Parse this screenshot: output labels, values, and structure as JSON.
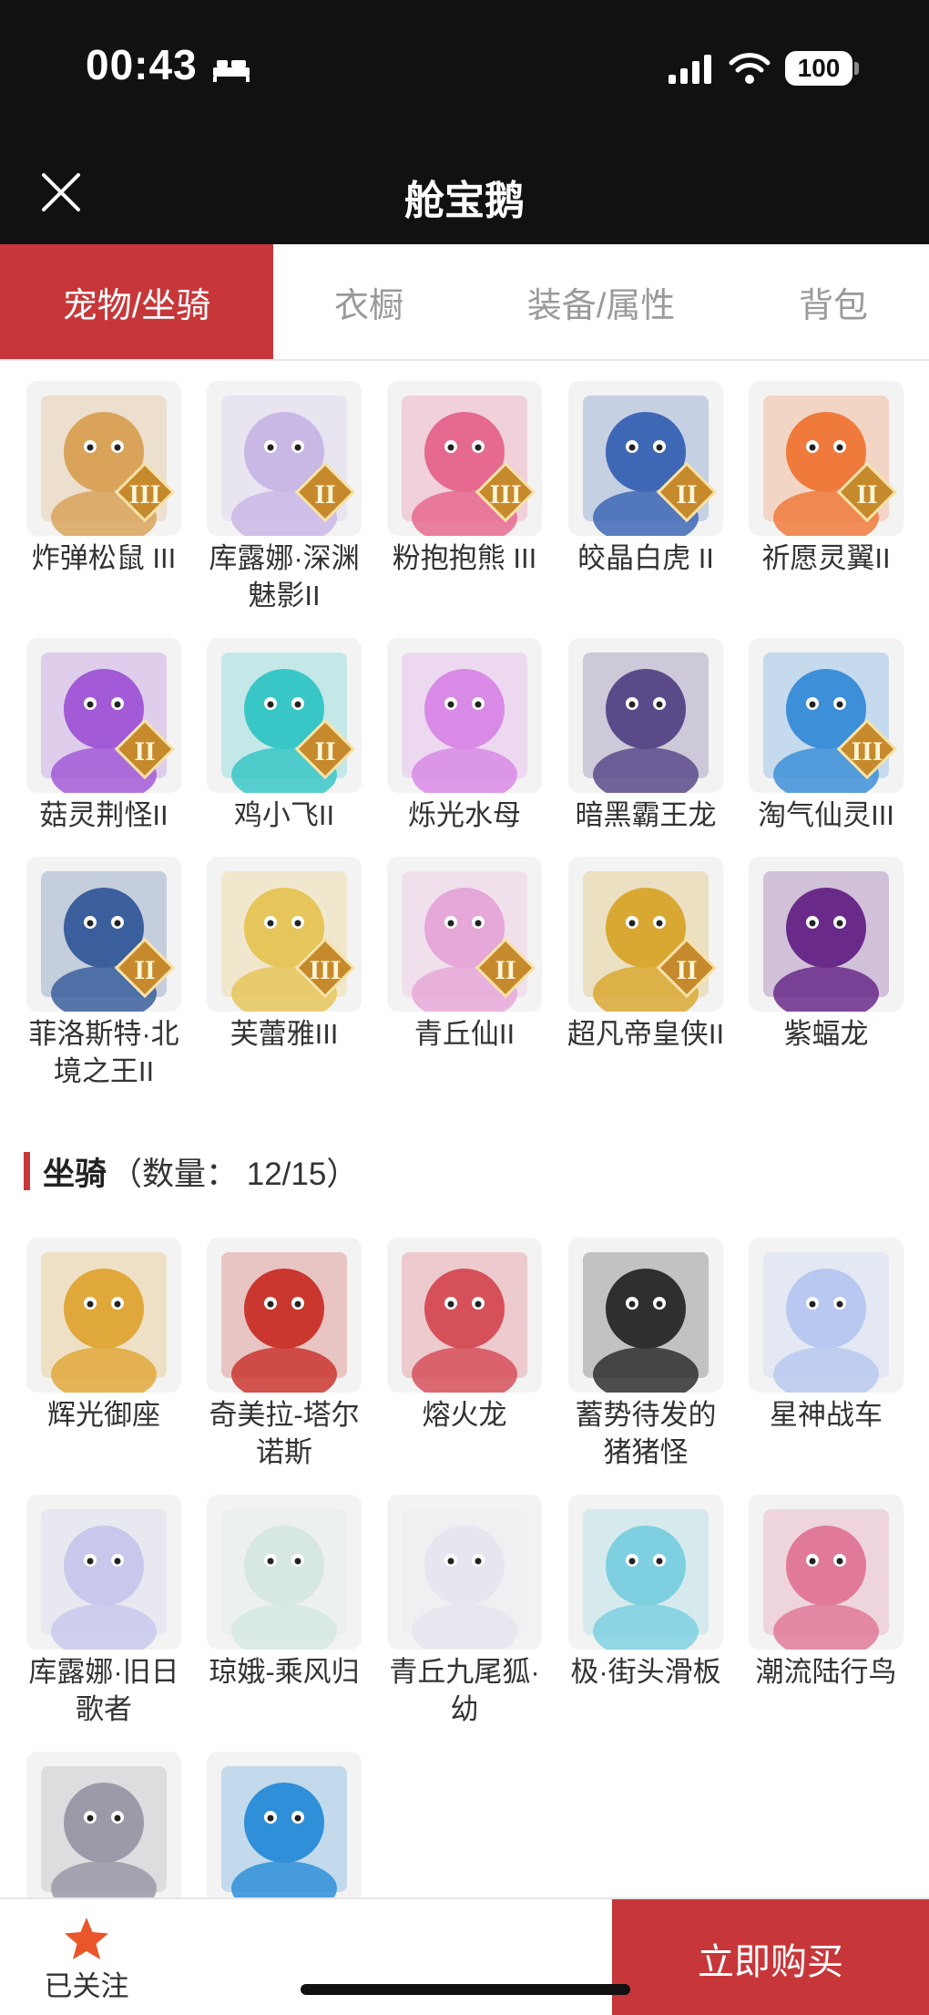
{
  "status_bar": {
    "time": "00:43",
    "battery": "100"
  },
  "app": {
    "title": "舱宝鹅"
  },
  "tabs": [
    {
      "label": "宠物/坐骑",
      "active": true
    },
    {
      "label": "衣橱",
      "active": false
    },
    {
      "label": "装备/属性",
      "active": false
    },
    {
      "label": "背包",
      "active": false
    }
  ],
  "pets": [
    {
      "name": "炸弹松鼠 III",
      "tier": "III",
      "color": "#d9a35a"
    },
    {
      "name": "库露娜·深渊魅影II",
      "tier": "II",
      "color": "#c9b7e6"
    },
    {
      "name": "粉抱抱熊 III",
      "tier": "III",
      "color": "#e66a8f"
    },
    {
      "name": "皎晶白虎 II",
      "tier": "II",
      "color": "#3e67b5"
    },
    {
      "name": "祈愿灵翼II",
      "tier": "II",
      "color": "#f07a3c"
    },
    {
      "name": "菇灵荆怪II",
      "tier": "II",
      "color": "#a25ad6"
    },
    {
      "name": "鸡小飞II",
      "tier": "II",
      "color": "#38c7c6"
    },
    {
      "name": "烁光水母",
      "tier": "",
      "color": "#d98ae6"
    },
    {
      "name": "暗黑霸王龙",
      "tier": "",
      "color": "#5a4a8a"
    },
    {
      "name": "淘气仙灵III",
      "tier": "III",
      "color": "#3d8fd8"
    },
    {
      "name": "菲洛斯特·北境之王II",
      "tier": "II",
      "color": "#3a5f9c"
    },
    {
      "name": "芙蕾雅III",
      "tier": "III",
      "color": "#e6c55a"
    },
    {
      "name": "青丘仙II",
      "tier": "II",
      "color": "#e6a8d8"
    },
    {
      "name": "超凡帝皇侠II",
      "tier": "II",
      "color": "#d9a833"
    },
    {
      "name": "紫蝠龙",
      "tier": "",
      "color": "#6a2a8a"
    }
  ],
  "mounts_section": {
    "title": "坐骑",
    "count": "（数量： 12/15）"
  },
  "mounts": [
    {
      "name": "辉光御座",
      "tier": "",
      "color": "#e0a83a"
    },
    {
      "name": "奇美拉-塔尔诺斯",
      "tier": "",
      "color": "#c9372f"
    },
    {
      "name": "熔火龙",
      "tier": "",
      "color": "#d6505a"
    },
    {
      "name": "蓄势待发的猪猪怪",
      "tier": "",
      "color": "#2f2f2f"
    },
    {
      "name": "星神战车",
      "tier": "",
      "color": "#b8c8f0"
    },
    {
      "name": "库露娜·旧日歌者",
      "tier": "",
      "color": "#c8c8ec"
    },
    {
      "name": "琼娥-乘风归",
      "tier": "",
      "color": "#d6e8e0"
    },
    {
      "name": "青丘九尾狐·幼",
      "tier": "",
      "color": "#e8e4f0"
    },
    {
      "name": "极·街头滑板",
      "tier": "",
      "color": "#7ed0e0"
    },
    {
      "name": "潮流陆行鸟",
      "tier": "",
      "color": "#e07a98"
    },
    {
      "name": "",
      "tier": "",
      "color": "#9a9aa8"
    },
    {
      "name": "",
      "tier": "",
      "color": "#2f8fd8"
    }
  ],
  "bottom_bar": {
    "follow_label": "已关注",
    "buy_label": "立即购买"
  },
  "colors": {
    "accent": "#c7373a",
    "header_bg": "#111111"
  }
}
